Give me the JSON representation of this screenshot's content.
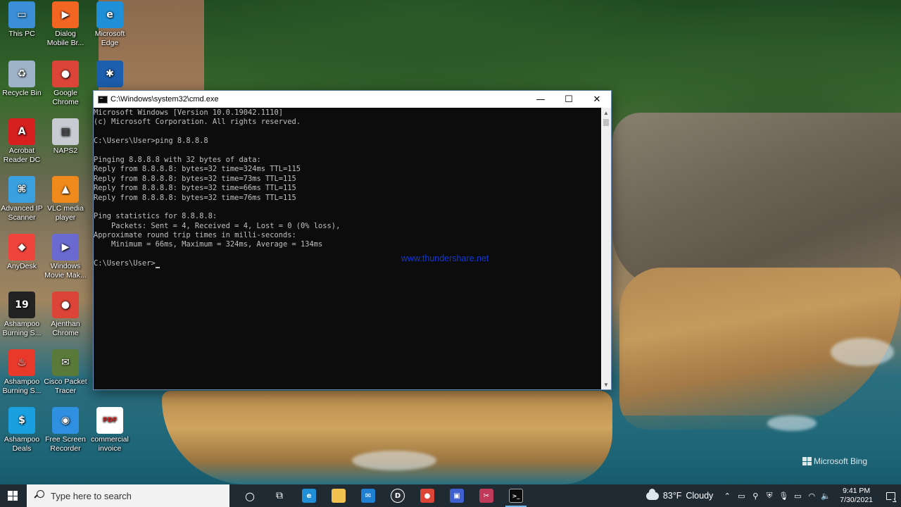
{
  "desktop": {
    "icons": [
      {
        "label": "This PC",
        "icon": "monitor-icon",
        "color": "#3a8fd6"
      },
      {
        "label": "Dialog Mobile Br...",
        "icon": "dialog-icon",
        "color": "#f26522"
      },
      {
        "label": "Microsoft Edge",
        "icon": "edge-icon",
        "color": "#1f8fd8"
      },
      {
        "label": "Recycle Bin",
        "icon": "recycle-bin-icon",
        "color": "#9fb3c8"
      },
      {
        "label": "Google Chrome",
        "icon": "chrome-icon",
        "color": "#db4437"
      },
      {
        "label": "",
        "icon": "app-icon",
        "color": "#1c5fae"
      },
      {
        "label": "Acrobat Reader DC",
        "icon": "acrobat-icon",
        "color": "#d61f1f"
      },
      {
        "label": "NAPS2",
        "icon": "scanner-icon",
        "color": "#c8ccd2"
      },
      {
        "label": "Advanced IP Scanner",
        "icon": "network-icon",
        "color": "#3aa0e0"
      },
      {
        "label": "VLC media player",
        "icon": "vlc-icon",
        "color": "#f08a1c"
      },
      {
        "label": "AnyDesk",
        "icon": "anydesk-icon",
        "color": "#ef443b"
      },
      {
        "label": "Windows Movie Mak...",
        "icon": "movie-maker-icon",
        "color": "#6a6ad0"
      },
      {
        "label": "Ashampoo Burning S...",
        "icon": "ashampoo-19-icon",
        "color": "#222222"
      },
      {
        "label": "Ajenthan Chrome",
        "icon": "chrome-profile-icon",
        "color": "#db4437"
      },
      {
        "label": "Ashampoo Burning S...",
        "icon": "ashampoo-flame-icon",
        "color": "#e8392b"
      },
      {
        "label": "Cisco Packet Tracer",
        "icon": "packet-tracer-icon",
        "color": "#5a7a3a"
      },
      {
        "label": "Ashampoo Deals",
        "icon": "deals-icon",
        "color": "#1aa0e0"
      },
      {
        "label": "Free Screen Recorder",
        "icon": "screen-recorder-icon",
        "color": "#2f8fe0"
      },
      {
        "label": "commercial invoice",
        "icon": "pdf-icon",
        "color": "#ffffff"
      }
    ],
    "watermark": "Microsoft Bing"
  },
  "cmd": {
    "title": "C:\\Windows\\system32\\cmd.exe",
    "minimize": "—",
    "maximize": "☐",
    "close": "✕",
    "lines": [
      "Microsoft Windows [Version 10.0.19042.1110]",
      "(c) Microsoft Corporation. All rights reserved.",
      "",
      "C:\\Users\\User>ping 8.8.8.8",
      "",
      "Pinging 8.8.8.8 with 32 bytes of data:",
      "Reply from 8.8.8.8: bytes=32 time=324ms TTL=115",
      "Reply from 8.8.8.8: bytes=32 time=73ms TTL=115",
      "Reply from 8.8.8.8: bytes=32 time=66ms TTL=115",
      "Reply from 8.8.8.8: bytes=32 time=76ms TTL=115",
      "",
      "Ping statistics for 8.8.8.8:",
      "    Packets: Sent = 4, Received = 4, Lost = 0 (0% loss),",
      "Approximate round trip times in milli-seconds:",
      "    Minimum = 66ms, Maximum = 324ms, Average = 134ms",
      ""
    ],
    "prompt": "C:\\Users\\User>",
    "overlay_watermark": "www.thundershare.net"
  },
  "taskbar": {
    "search_placeholder": "Type here to search",
    "apps": [
      {
        "name": "cortana",
        "icon": "cortana-icon",
        "glyph": "○",
        "color": "transparent"
      },
      {
        "name": "task-view",
        "icon": "task-view-icon",
        "glyph": "⧉",
        "color": "transparent"
      },
      {
        "name": "edge",
        "icon": "edge-icon",
        "glyph": "e",
        "color": "#1f8fd8"
      },
      {
        "name": "file-explorer",
        "icon": "folder-icon",
        "glyph": "",
        "color": "#f2c14e"
      },
      {
        "name": "mail",
        "icon": "mail-icon",
        "glyph": "✉",
        "color": "#1f7fd0"
      },
      {
        "name": "dell",
        "icon": "dell-icon",
        "glyph": "D",
        "color": "#2a2f36"
      },
      {
        "name": "chrome-profile",
        "icon": "chrome-icon",
        "glyph": "●",
        "color": "#db4437"
      },
      {
        "name": "remote-desktop",
        "icon": "remote-desktop-icon",
        "glyph": "▣",
        "color": "#3f5fd0"
      },
      {
        "name": "snipping",
        "icon": "snipping-icon",
        "glyph": "✂",
        "color": "#c03a5a"
      },
      {
        "name": "cmd",
        "icon": "terminal-icon",
        "glyph": ">_",
        "color": "#0c0c0c"
      }
    ],
    "weather": {
      "temp": "83°F",
      "condition": "Cloudy"
    },
    "tray_icons": [
      "chevron-up-icon",
      "display-icon",
      "usb-icon",
      "security-icon",
      "microphone-icon",
      "battery-icon",
      "wifi-icon",
      "volume-icon"
    ],
    "time": "9:41 PM",
    "date": "7/30/2021"
  }
}
